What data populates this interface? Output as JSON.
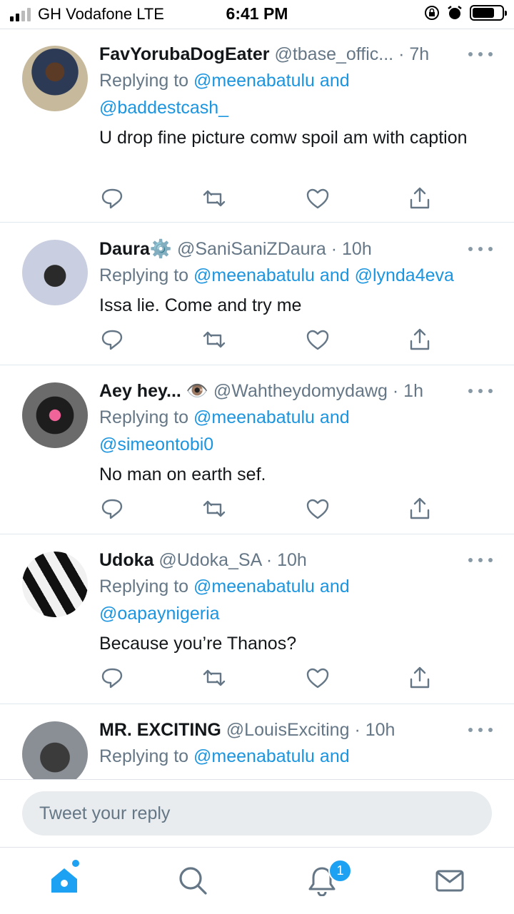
{
  "status_bar": {
    "carrier": "GH Vodafone  LTE",
    "time": "6:41 PM",
    "icons": [
      "signal-icon",
      "orientation-lock-icon",
      "alarm-icon",
      "battery-icon"
    ]
  },
  "tweets": [
    {
      "name": "FavYorubaDogEater",
      "handle": "@tbase_offic...",
      "time": "· 7h",
      "reply_prefix": "Replying to ",
      "reply_line1_link": "@meenabatulu and",
      "reply_line2_link": "@baddestcash_",
      "text": "U drop fine picture comw spoil am with caption"
    },
    {
      "name": "Daura",
      "name_emoji": "⚙️",
      "handle": "@SaniSaniZDaura",
      "time": "· 10h",
      "reply_prefix": "Replying to ",
      "reply_line1_link": "@meenabatulu and @lynda4eva",
      "text": "Issa lie. Come and try me"
    },
    {
      "name": "Aey hey...",
      "name_emoji": "👁️",
      "handle": "@Wahtheydomydawg",
      "time": "· 1h",
      "reply_prefix": "Replying to ",
      "reply_line1_link": "@meenabatulu and",
      "reply_line2_link": "@simeontobi0",
      "text": "No man on earth sef."
    },
    {
      "name": "Udoka",
      "handle": "@Udoka_SA",
      "time": "· 10h",
      "reply_prefix": "Replying to ",
      "reply_line1_link": "@meenabatulu and",
      "reply_line2_link": "@oapaynigeria",
      "text": "Because you’re Thanos?"
    },
    {
      "name": "MR. EXCITING",
      "handle": "@LouisExciting",
      "time": "· 10h",
      "reply_prefix": "Replying to ",
      "reply_line1_link": "@meenabatulu and"
    }
  ],
  "composer": {
    "placeholder": "Tweet your reply"
  },
  "tabbar": {
    "tabs": [
      "home-icon",
      "search-icon",
      "notifications-icon",
      "messages-icon"
    ],
    "notification_count": "1"
  },
  "colors": {
    "accent": "#1da1f2",
    "link": "#1b95e0",
    "secondary_text": "#657786"
  }
}
